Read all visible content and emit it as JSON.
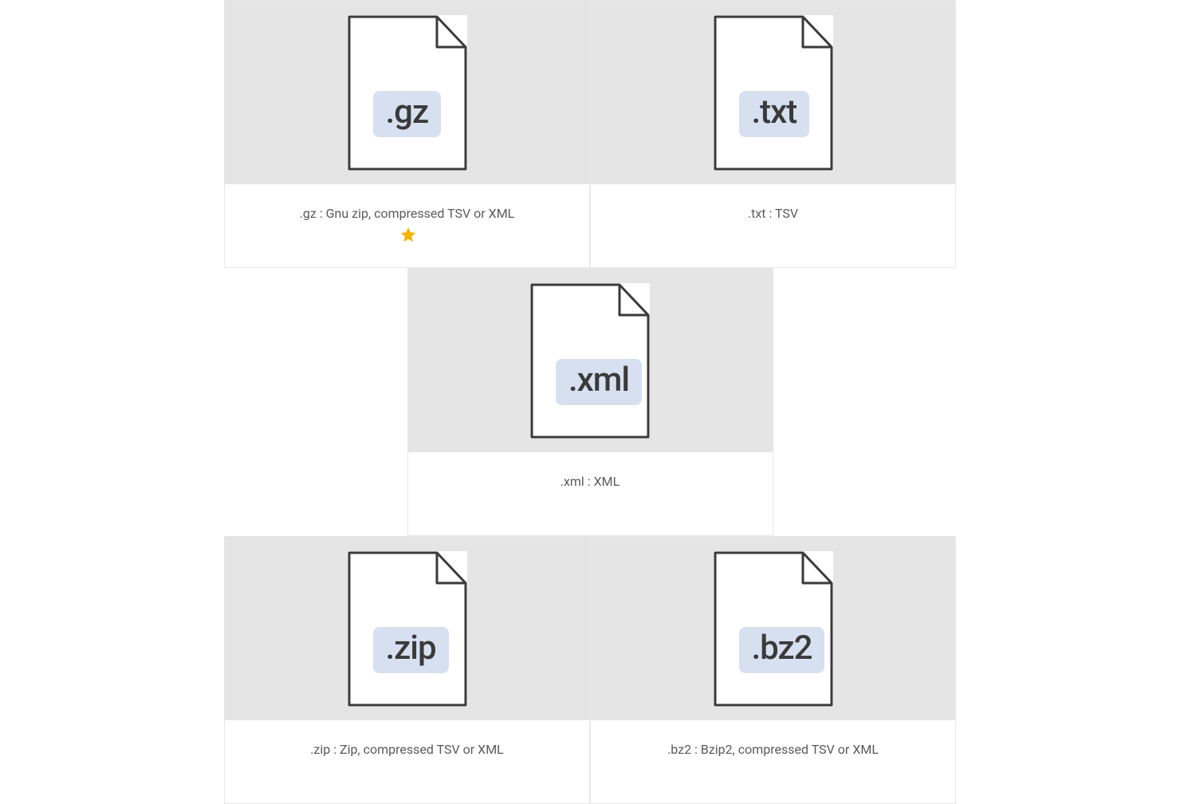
{
  "cards": [
    {
      "ext": ".gz",
      "caption": ".gz : Gnu zip, compressed TSV or XML",
      "starred": true
    },
    {
      "ext": ".txt",
      "caption": ".txt : TSV",
      "starred": false
    },
    {
      "ext": ".xml",
      "caption": ".xml : XML",
      "starred": false
    },
    {
      "ext": ".zip",
      "caption": ".zip : Zip, compressed TSV or XML",
      "starred": false
    },
    {
      "ext": ".bz2",
      "caption": ".bz2 : Bzip2, compressed TSV or XML",
      "starred": false
    }
  ],
  "colors": {
    "badge_bg": "#d6e0f0",
    "card_image_bg": "#e5e5e5",
    "star": "#f4b400"
  }
}
